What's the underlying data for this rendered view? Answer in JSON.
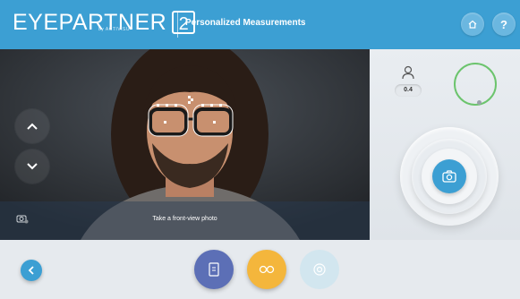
{
  "header": {
    "logo_text": "EYEPARTNER",
    "logo_version": "2",
    "logo_subtext": "by ACTIVISU",
    "title": "Personalized Measurements",
    "home_icon": "home-icon",
    "help_label": "?"
  },
  "camera": {
    "caption": "Take a front-view photo",
    "up_icon": "chevron-up-icon",
    "down_icon": "chevron-down-icon",
    "settings_icon": "camera-settings-icon"
  },
  "right_panel": {
    "person_icon": "person-icon",
    "distance_value": "0.4",
    "level_indicator_color": "#6cc46d",
    "capture_icon": "camera-icon"
  },
  "bottom_bar": {
    "back_icon": "chevron-left-icon",
    "steps": [
      {
        "name": "frame-step",
        "icon": "document-icon",
        "color": "#5c6fb6",
        "active": true
      },
      {
        "name": "glasses-step",
        "icon": "glasses-icon",
        "color": "#f4b63c",
        "active": true
      },
      {
        "name": "lens-step",
        "icon": "lens-target-icon",
        "color": "#d2e6ef",
        "active": false
      }
    ]
  },
  "colors": {
    "accent": "#3c9fd3"
  }
}
